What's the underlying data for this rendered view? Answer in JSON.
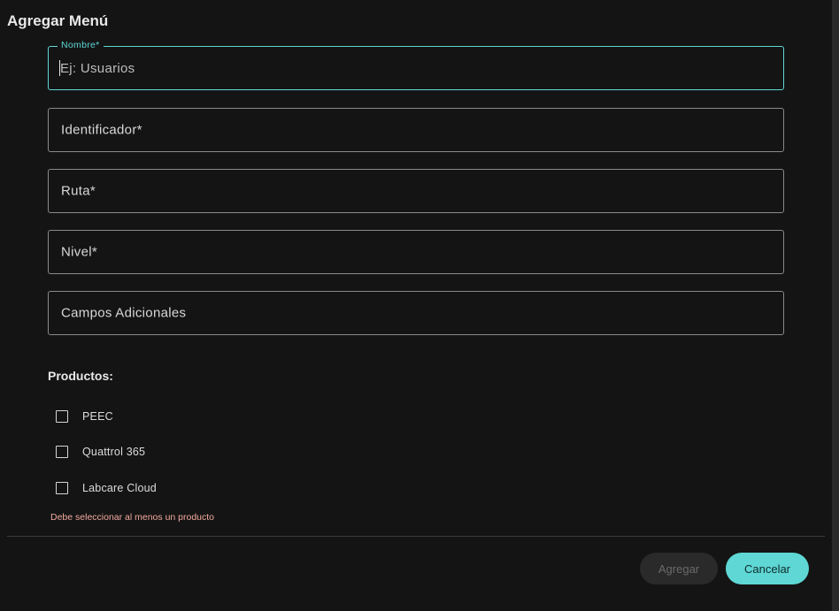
{
  "dialog": {
    "title": "Agregar Menú"
  },
  "form": {
    "nombre": {
      "label": "Nombre*",
      "placeholder": "Ej: Usuarios",
      "value": ""
    },
    "identificador": {
      "label": "Identificador*"
    },
    "ruta": {
      "label": "Ruta*"
    },
    "nivel": {
      "label": "Nivel*"
    },
    "campos_adicionales": {
      "label": "Campos Adicionales"
    }
  },
  "productos": {
    "title": "Productos:",
    "items": [
      {
        "label": "PEEC",
        "checked": false
      },
      {
        "label": "Quattrol 365",
        "checked": false
      },
      {
        "label": "Labcare Cloud",
        "checked": false
      }
    ],
    "error": "Debe seleccionar al menos un producto"
  },
  "actions": {
    "add_label": "Agregar",
    "cancel_label": "Cancelar"
  },
  "colors": {
    "accent": "#5ed7d5",
    "error": "#f2a99d",
    "background": "#141414"
  }
}
